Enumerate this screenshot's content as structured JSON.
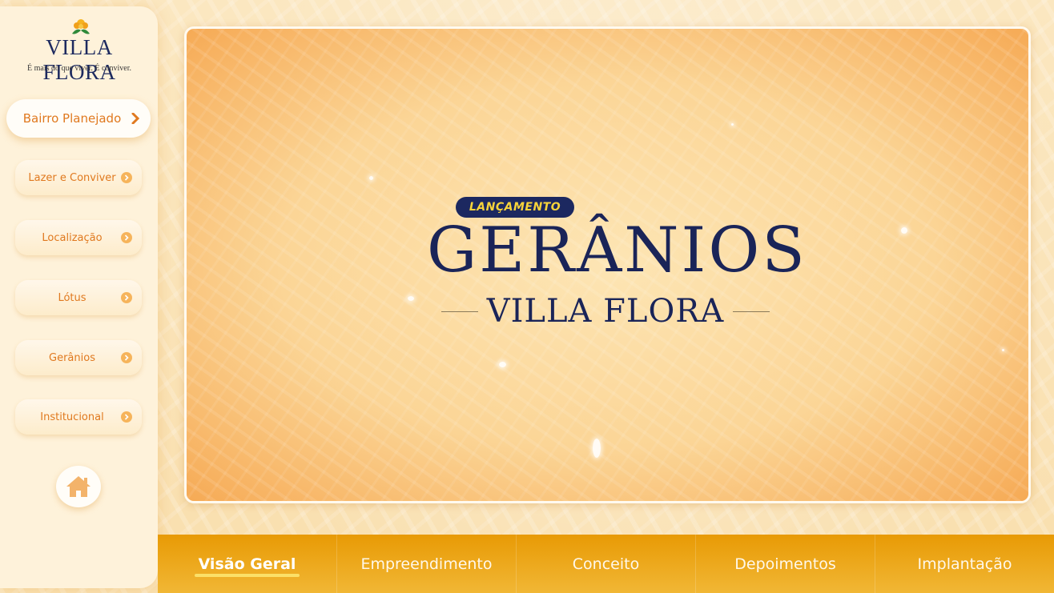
{
  "brand": {
    "name": "VILLA FLORA",
    "tagline": "É mais do que viver. É conviver."
  },
  "sidebar": {
    "items": [
      {
        "label": "Bairro Planejado",
        "active": true
      },
      {
        "label": "Lazer e Conviver"
      },
      {
        "label": "Localização"
      },
      {
        "label": "Lótus"
      },
      {
        "label": "Gerânios"
      },
      {
        "label": "Institucional"
      }
    ],
    "home_icon": "home-icon"
  },
  "video": {
    "badge": "LANÇAMENTO",
    "title": "GERÂNIOS",
    "subtitle": "VILLA FLORA"
  },
  "tabs": [
    {
      "label": "Visão Geral",
      "active": true
    },
    {
      "label": "Empreendimento"
    },
    {
      "label": "Conceito"
    },
    {
      "label": "Depoimentos"
    },
    {
      "label": "Implantação"
    }
  ],
  "colors": {
    "accent": "#e0791f",
    "navy": "#1a2458",
    "tabbar": "#e89a05",
    "badge_text": "#f8d43a"
  }
}
